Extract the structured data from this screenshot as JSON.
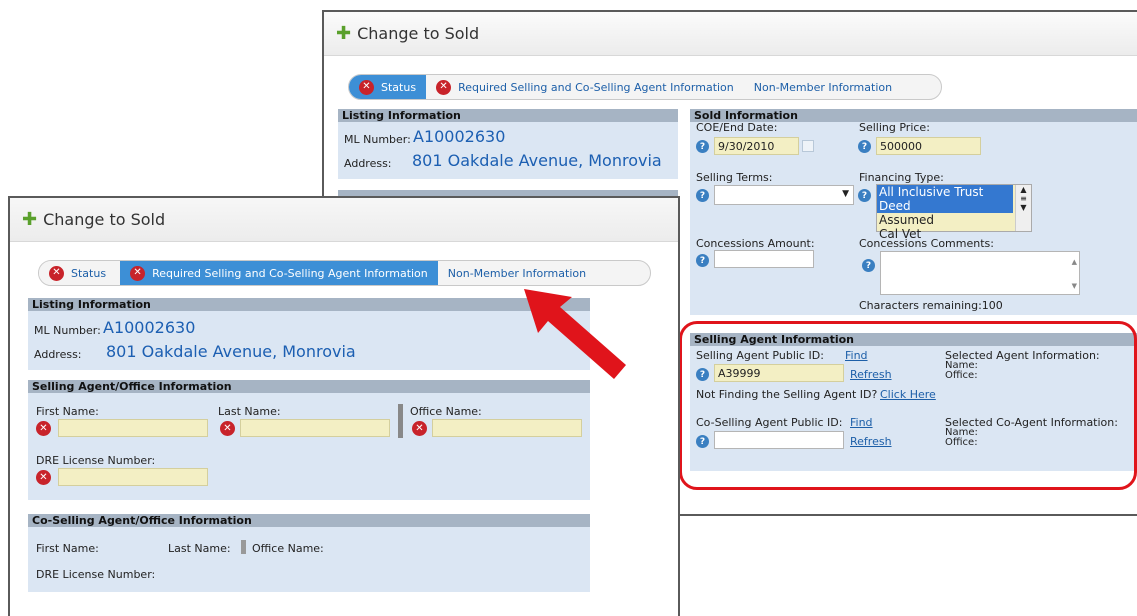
{
  "back": {
    "title": "Change to Sold",
    "steps": [
      "Status",
      "Required Selling and Co-Selling Agent Information",
      "Non-Member Information"
    ],
    "listing": {
      "head": "Listing Information",
      "ml_label": "ML Number:",
      "ml": "A10002630",
      "addr_label": "Address:",
      "addr": "801 Oakdale Avenue, Monrovia"
    },
    "sold": {
      "head": "Sold Information",
      "coe_label": "COE/End Date:",
      "coe": "9/30/2010",
      "price_label": "Selling Price:",
      "price": "500000",
      "terms_label": "Selling Terms:",
      "fin_label": "Financing Type:",
      "fin_opts": [
        "All Inclusive Trust Deed",
        "Assumed",
        "Cal Vet"
      ],
      "conc_label": "Concessions Amount:",
      "concc_label": "Concessions Comments:",
      "chars": "Characters remaining:100"
    },
    "agent": {
      "head": "Selling Agent Information",
      "pid_label": "Selling Agent Public ID:",
      "find": "Find",
      "pid": "A39999",
      "refresh": "Refresh",
      "notfound": "Not Finding the Selling Agent ID?",
      "click": "Click Here",
      "sel_label": "Selected Agent Information:",
      "name": "Name:",
      "office": "Office:",
      "co_label": "Co-Selling Agent Public ID:",
      "co_sel": "Selected Co-Agent Information:"
    }
  },
  "front": {
    "title": "Change to Sold",
    "steps": [
      "Status",
      "Required Selling and Co-Selling Agent Information",
      "Non-Member Information"
    ],
    "listing": {
      "head": "Listing Information",
      "ml_label": "ML Number:",
      "ml": "A10002630",
      "addr_label": "Address:",
      "addr": "801 Oakdale Avenue, Monrovia"
    },
    "office": {
      "head": "Selling Agent/Office Information",
      "first": "First Name:",
      "last": "Last Name:",
      "office": "Office Name:",
      "dre": "DRE License Number:"
    },
    "co": {
      "head": "Co-Selling Agent/Office Information",
      "first": "First Name:",
      "last": "Last Name:",
      "office": "Office Name:",
      "dre": "DRE License Number:"
    }
  },
  "colors": {
    "highlight": "#e0141b",
    "accent": "#3d8fd6"
  }
}
